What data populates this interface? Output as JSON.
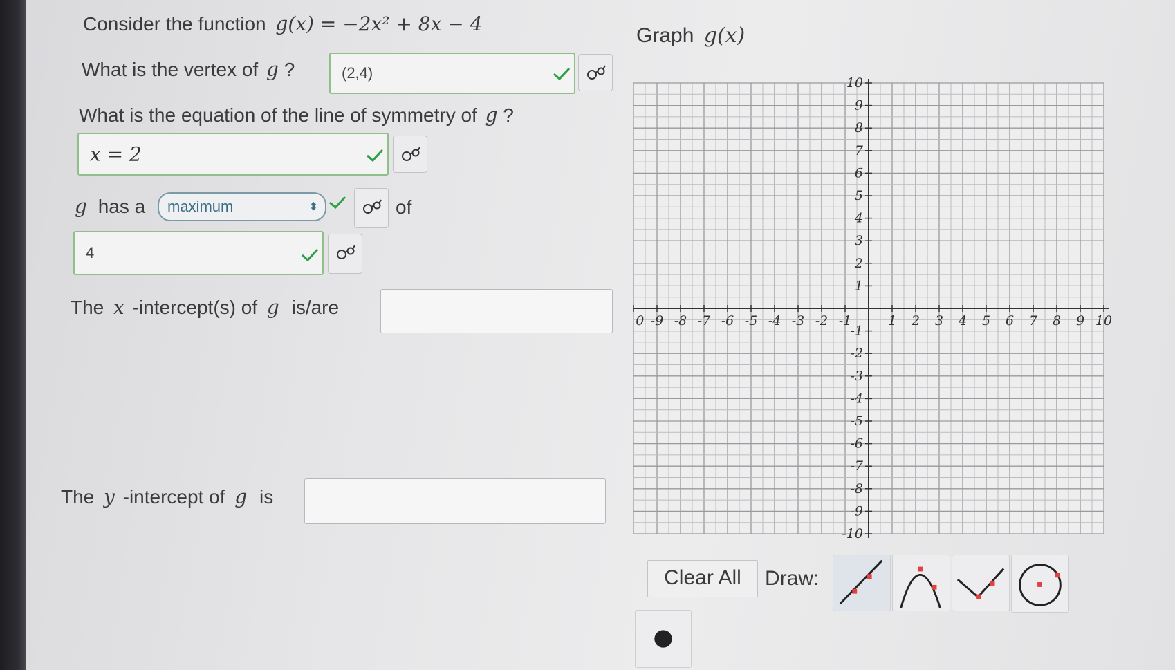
{
  "q_function": {
    "prefix": "Consider the function",
    "formula": "g(x) = −2x² + 8x − 4"
  },
  "q_vertex": {
    "prefix": "What is the vertex of",
    "var": "g",
    "suffix": "?",
    "answer": "(2,4)"
  },
  "q_symmetry": {
    "prefix": "What is the equation of the line of symmetry of",
    "var": "g",
    "suffix": "?",
    "answer": "x = 2"
  },
  "q_extreme": {
    "var": "g",
    "has_a": "has a",
    "select_value": "maximum",
    "of": "of",
    "answer": "4"
  },
  "q_xint": {
    "prefix": "The",
    "var": "x",
    "middle": "-intercept(s) of",
    "fn": "g",
    "suffix": "is/are",
    "answer": ""
  },
  "q_yint": {
    "prefix": "The",
    "var": "y",
    "middle": "-intercept of",
    "fn": "g",
    "suffix": "is",
    "answer": ""
  },
  "graph": {
    "title_prefix": "Graph",
    "title_fn": "g(x)",
    "x_range": [
      -10,
      10
    ],
    "y_range": [
      -10,
      10
    ],
    "x_ticks": [
      "-10",
      "-9",
      "-8",
      "-7",
      "-6",
      "-5",
      "-4",
      "-3",
      "-2",
      "-1",
      "1",
      "2",
      "3",
      "4",
      "5",
      "6",
      "7",
      "8",
      "9",
      "10"
    ],
    "y_ticks": [
      "10",
      "9",
      "8",
      "7",
      "6",
      "5",
      "4",
      "3",
      "2",
      "1",
      "-1",
      "-2",
      "-3",
      "-4",
      "-5",
      "-6",
      "-7",
      "-8",
      "-9",
      "-10"
    ],
    "minor_per_unit": 2
  },
  "tools": {
    "clear_label": "Clear All",
    "draw_label": "Draw:",
    "items": [
      "line-tool-icon",
      "parabola-tool-icon",
      "absolute-value-tool-icon",
      "circle-tool-icon",
      "point-tool-icon"
    ]
  },
  "colors": {
    "correct": "#2e9e45",
    "tool_red": "#e04040",
    "select_blue": "#3b6d86"
  }
}
